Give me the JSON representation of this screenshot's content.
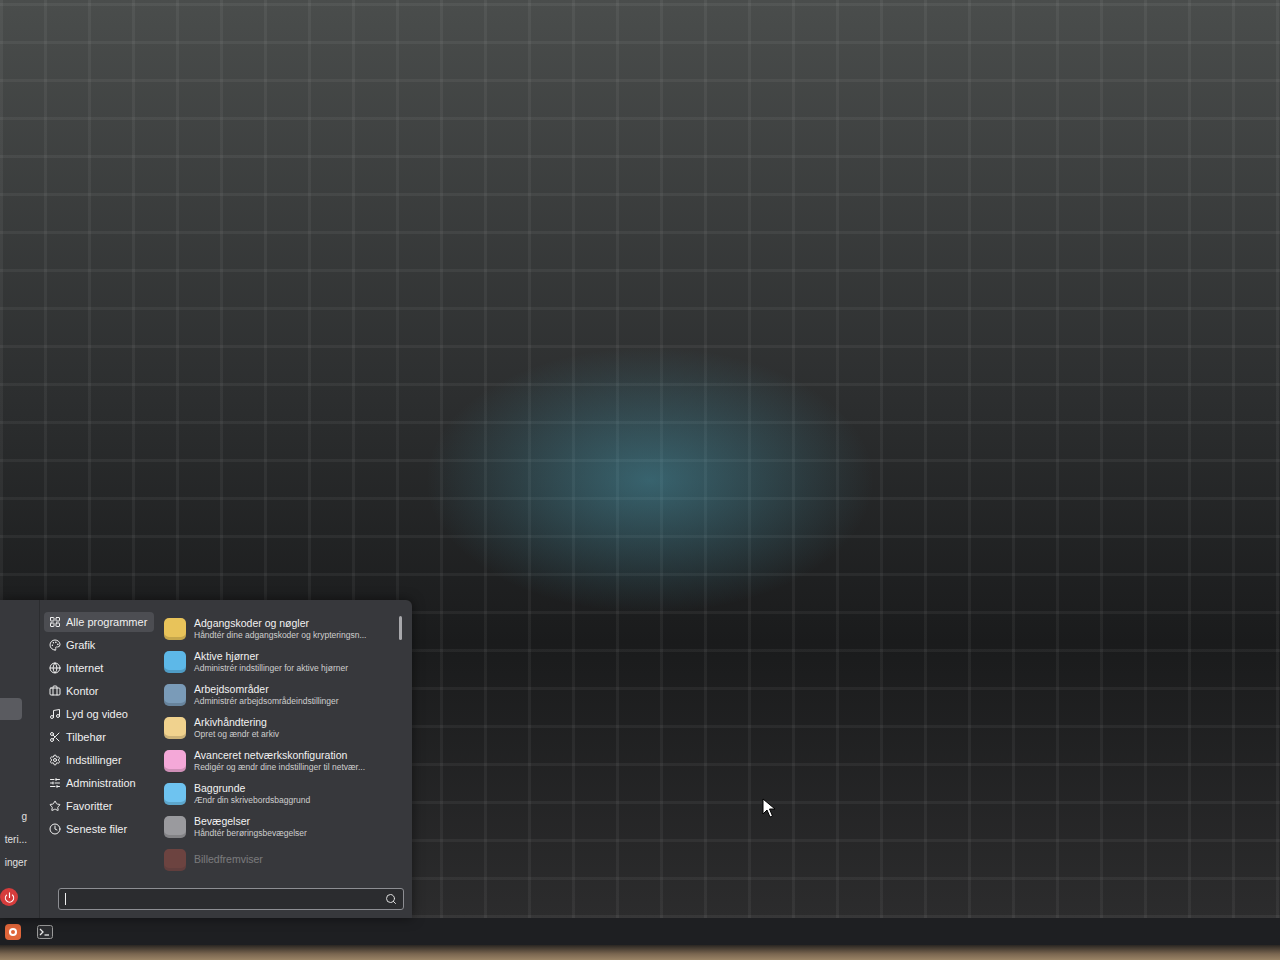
{
  "menu": {
    "sidebar": {
      "favorites": [
        {
          "selected": true
        }
      ],
      "places": [
        {
          "label": "g"
        },
        {
          "label": "teri..."
        },
        {
          "label": "inger"
        }
      ]
    },
    "categories": [
      {
        "label": "Alle programmer",
        "selected": true
      },
      {
        "label": "Grafik",
        "selected": false
      },
      {
        "label": "Internet",
        "selected": false
      },
      {
        "label": "Kontor",
        "selected": false
      },
      {
        "label": "Lyd og video",
        "selected": false
      },
      {
        "label": "Tilbehør",
        "selected": false
      },
      {
        "label": "Indstillinger",
        "selected": false
      },
      {
        "label": "Administration",
        "selected": false
      },
      {
        "label": "Favoritter",
        "selected": false
      },
      {
        "label": "Seneste filer",
        "selected": false
      }
    ],
    "apps": [
      {
        "title": "Adgangskoder og nøgler",
        "description": "Håndtér dine adgangskoder og krypteringsn...",
        "color": "#e8c35a",
        "faded": false
      },
      {
        "title": "Aktive hjørner",
        "description": "Administrér indstillinger for aktive hjørner",
        "color": "#5db8e8",
        "faded": false
      },
      {
        "title": "Arbejdsområder",
        "description": "Administrér arbejdsområdeindstillinger",
        "color": "#7a9bb8",
        "faded": false
      },
      {
        "title": "Arkivhåndtering",
        "description": "Opret og ændr et arkiv",
        "color": "#f0d28e",
        "faded": false
      },
      {
        "title": "Avanceret netværkskonfiguration",
        "description": "Redigér og ændr dine indstillinger til netvær...",
        "color": "#f4a8d8",
        "faded": false
      },
      {
        "title": "Baggrunde",
        "description": "Ændr din skrivebordsbaggrund",
        "color": "#6ec3f0",
        "faded": false
      },
      {
        "title": "Bevægelser",
        "description": "Håndtér berøringsbevægelser",
        "color": "#9a9a9e",
        "faded": false
      },
      {
        "title": "Billedfremviser",
        "description": "",
        "color": "#d0584a",
        "faded": true
      }
    ],
    "search": {
      "value": "",
      "focused": true
    }
  },
  "taskbar": {
    "items": [
      {
        "kind": "menu"
      },
      {
        "kind": "terminal"
      }
    ]
  }
}
